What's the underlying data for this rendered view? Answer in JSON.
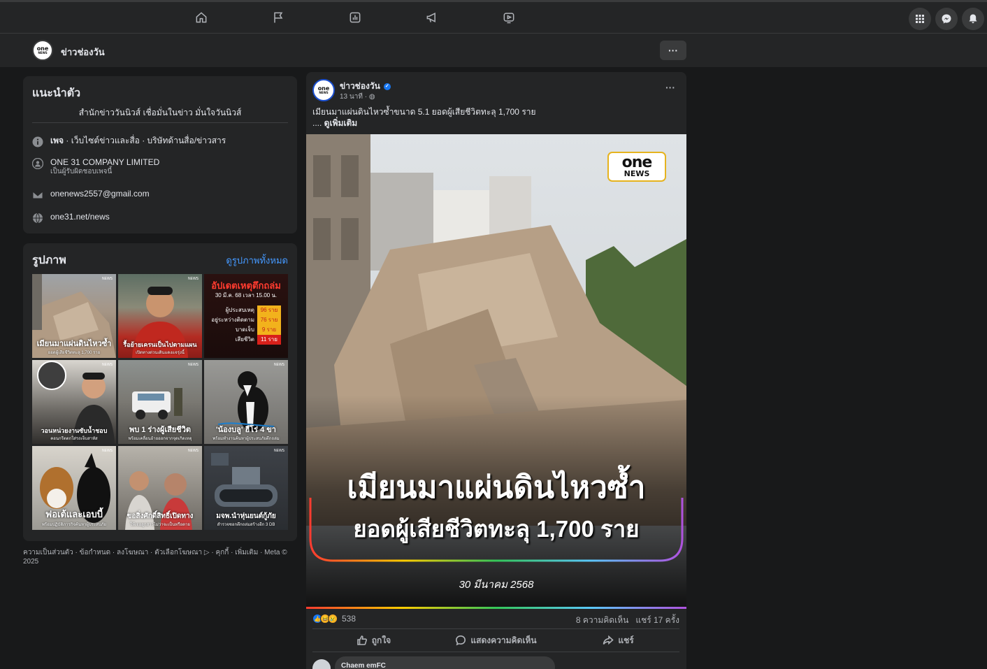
{
  "page": {
    "name": "ข่าวช่องวัน",
    "more": "···"
  },
  "logo": {
    "line1": "one",
    "line2": "NEWS"
  },
  "intro": {
    "title": "แนะนำตัว",
    "bio": "สำนักข่าววันนิวส์ เชื่อมั่นในข่าว มั่นใจวันนิวส์",
    "category_bold": "เพจ",
    "category": " · เว็บไซต์ข่าวและสื่อ · บริษัทด้านสื่อ/ข่าวสาร",
    "company": "ONE 31 COMPANY LIMITED",
    "company_sub": "เป็นผู้รับผิดชอบเพจนี้",
    "email": "onenews2557@gmail.com",
    "website": "one31.net/news"
  },
  "photos": {
    "title": "รูปภาพ",
    "see_all": "ดูรูปภาพทั้งหมด",
    "items": [
      {
        "caption": "เมียนมาแผ่นดินไหวซ้ำ",
        "sub": "ยอดผู้เสียชีวิตทะลุ 1,700 ราย"
      },
      {
        "caption": "รื้อย้ายเครนเป็นไปตามแผน",
        "sub": "เปิดทางด่วนเดินแดงแจรุ่งนี้"
      },
      {
        "caption": "อัปเดตเหตุตึกถล่ม",
        "sub": "30 มี.ค. 68 เวลา 15.00 น."
      },
      {
        "caption": "วอนหน่วยงานซับน้ำชอบ",
        "sub": "คอนกรีตตกใส่รถเจ็บสาหัส"
      },
      {
        "caption": "พบ 1 ร่างผู้เสียชีวิต",
        "sub": "พร้อมเคลื่อนย้ายออกจากจุดเกิดเหตุ"
      },
      {
        "caption": "'น้องบลู' ฮีโร่ 4 ขา",
        "sub": "พร้อมทำงานค้นหาผู้ประสบภัยตึกถล่ม"
      },
      {
        "caption": "ฟอเต้และเอบบี้",
        "sub": "พร้อมปฏิบัติภารกิจค้นหาผู้ประสบภัย"
      },
      {
        "caption": "ขอสิ่งศักดิ์สิทธิ์เปิดทาง",
        "sub": "ให้เจอลูกสาวไม่ว่าจะเป็นหรือตาย"
      },
      {
        "caption": "มจพ.นำหุ่นยนต์กู้ภัย",
        "sub": "สำรวจซอกตึกถล่มสร้างอีก 3 DB"
      }
    ],
    "infographic": {
      "rows": [
        {
          "label": "ผู้ประสบเหตุ",
          "value": "96 ราย"
        },
        {
          "label": "อยู่ระหว่างติดตาม",
          "value": "76 ราย"
        },
        {
          "label": "บาดเจ็บ",
          "value": "9 ราย"
        },
        {
          "label": "เสียชีวิต",
          "value": "11 ราย"
        }
      ]
    }
  },
  "footer": "ความเป็นส่วนตัว · ข้อกำหนด · ลงโฆษณา · ตัวเลือกโฆษณา ▷ · คุกกี้ · เพิ่มเติม · Meta © 2025",
  "post": {
    "author": "ข่าวช่องวัน",
    "time": "13 นาที · ",
    "text": "เมียนมาแผ่นดินไหวซ้ำขนาด 5.1 ยอดผู้เสียชีวิตทะลุ 1,700 ราย",
    "ellipsis": ".... ",
    "see_more": "ดูเพิ่มเติม",
    "image": {
      "headline": "เมียนมาแผ่นดินไหวซ้ำ",
      "subline": "ยอดผู้เสียชีวิตทะลุ 1,700 ราย",
      "date": "30 มีนาคม 2568"
    },
    "reaction_count": "538",
    "comments": "8 ความคิดเห็น",
    "shares": "แชร์ 17 ครั้ง",
    "actions": {
      "like": "ถูกใจ",
      "comment": "แสดงความคิดเห็น",
      "share": "แชร์"
    },
    "first_commenter": "Chaem emFC"
  },
  "colors": {
    "background": "#18191a",
    "surface": "#242526",
    "link": "#4599ff",
    "verified": "#1877f2"
  },
  "icons": [
    "home-icon",
    "flag-icon",
    "insights-icon",
    "megaphone-icon",
    "video-icon",
    "apps-grid-icon",
    "messenger-icon",
    "bell-icon"
  ]
}
